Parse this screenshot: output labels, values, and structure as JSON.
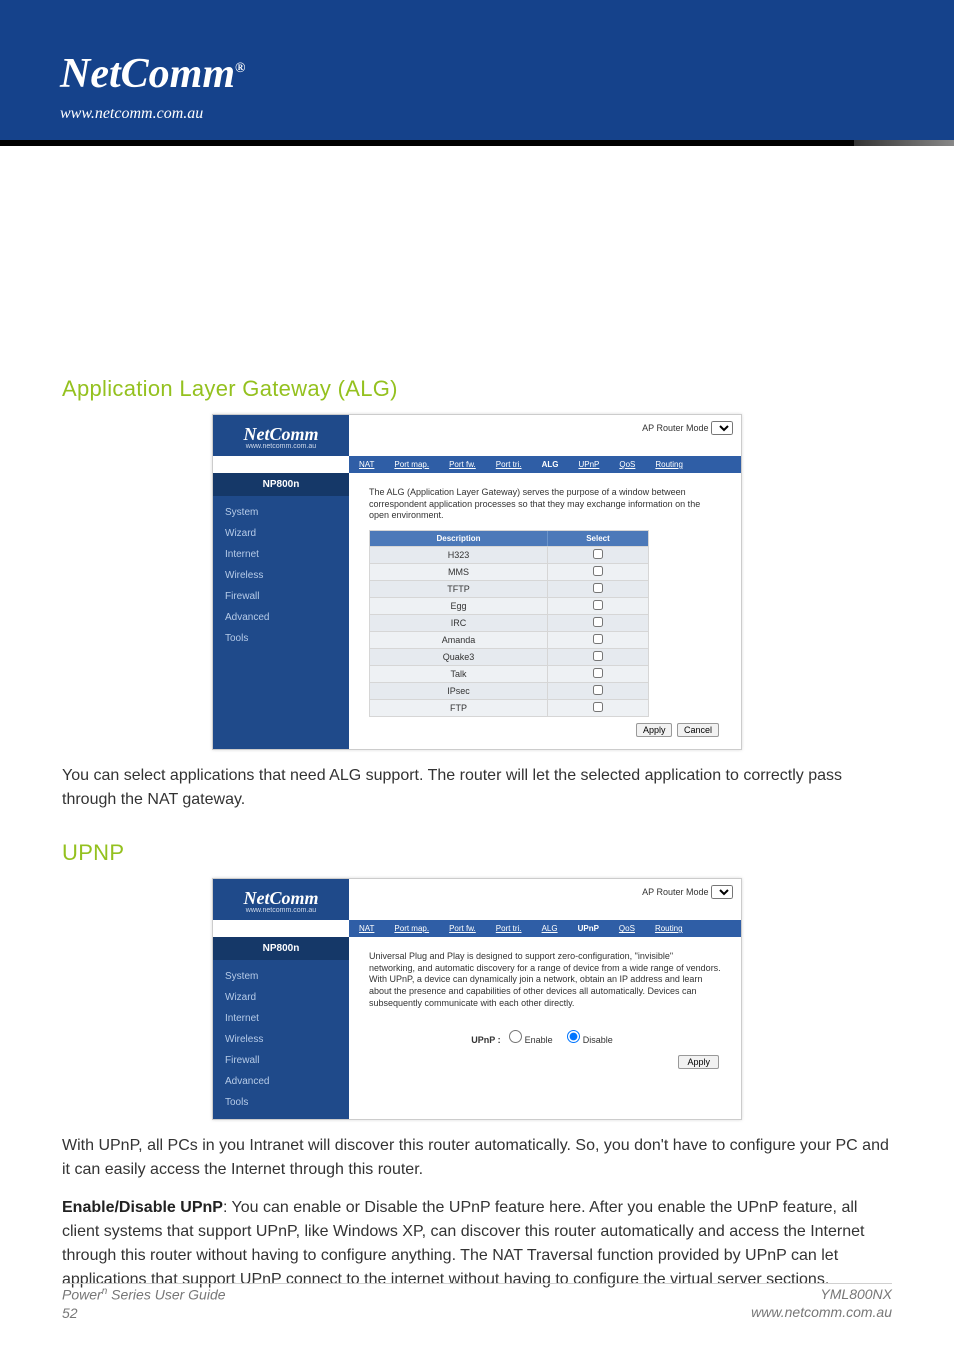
{
  "header": {
    "brand": "NetComm",
    "reg": "®",
    "url": "www.netcomm.com.au"
  },
  "sections": {
    "alg": {
      "title": "Application Layer Gateway (ALG)",
      "body": "You can select applications that need ALG support. The router will let the selected application to correctly pass through the NAT gateway."
    },
    "upnp": {
      "title": "UPNP",
      "body1": "With UPnP, all PCs in you Intranet will discover this router automatically. So, you don't have to configure your PC and it can easily access the Internet through this router.",
      "lead": "Enable/Disable UPnP",
      "body2": ":  You can enable or Disable the UPnP feature here. After you enable the UPnP feature, all client systems that support UPnP, like Windows XP, can discover this router automatically and access the Internet through this router without having to configure anything. The NAT Traversal function provided by UPnP can let applications that support UPnP connect to the internet without having to configure the virtual server sections."
    }
  },
  "screenshot_common": {
    "brand": "NetComm",
    "brand_url": "www.netcomm.com.au",
    "mode_label": "AP Router Mode",
    "model": "NP800n",
    "nav": [
      "System",
      "Wizard",
      "Internet",
      "Wireless",
      "Firewall",
      "Advanced",
      "Tools"
    ],
    "tabs": [
      "NAT",
      "Port map.",
      "Port fw.",
      "Port tri.",
      "ALG",
      "UPnP",
      "QoS",
      "Routing"
    ]
  },
  "alg_ss": {
    "active_tab": "ALG",
    "intro": "The ALG (Application Layer Gateway) serves the purpose of a window between correspondent application processes so that they may exchange information on the open environment.",
    "th": {
      "desc": "Description",
      "select": "Select"
    },
    "rows": [
      "H323",
      "MMS",
      "TFTP",
      "Egg",
      "IRC",
      "Amanda",
      "Quake3",
      "Talk",
      "IPsec",
      "FTP"
    ],
    "btn_apply": "Apply",
    "btn_cancel": "Cancel"
  },
  "upnp_ss": {
    "active_tab": "UPnP",
    "intro": "Universal Plug and Play is designed to support zero-configuration, \"invisible\" networking, and automatic discovery for a range of device from a wide range of vendors. With UPnP, a device can dynamically join a network, obtain an IP address and learn about the presence and capabilities of other devices all automatically. Devices can subsequently communicate with each other directly.",
    "label": "UPnP :",
    "enable": "Enable",
    "disable": "Disable",
    "btn_apply": "Apply"
  },
  "footer": {
    "left1": "Power",
    "sup": "n",
    "left2": " Series User Guide",
    "left3": "52",
    "right1": "YML800NX",
    "right2": "www.netcomm.com.au"
  }
}
